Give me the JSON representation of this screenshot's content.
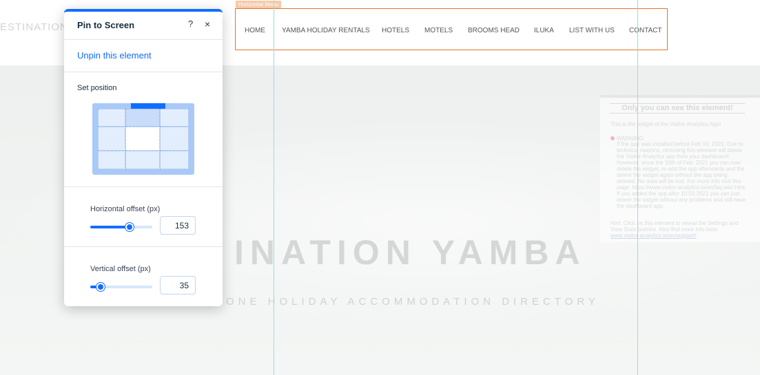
{
  "site": {
    "logo_text": "ESTINATION Y",
    "menu_tag": "Horizontal Menu",
    "menu_items": [
      "HOME",
      "YAMBA HOLIDAY RENTALS",
      "HOTELS",
      "MOTELS",
      "BROOMS HEAD",
      "ILUKA",
      "LIST WITH US",
      "CONTACT"
    ],
    "hero_title": "INATION YAMBA",
    "hero_subtitle": "ONE HOLIDAY ACCOMMODATION DIRECTORY"
  },
  "widget": {
    "title": "Only you can see this element!",
    "intro": "This is the widget of the Visitor Analytics App!",
    "warning_label": "WARNING:",
    "warning_text": "If the app was installed before Feb 10, 2021: Due to technical reasons, removing this element will delete the Visitor Analytics app from your dashboard! However, since the 10th of Feb. 2021 you can now delete the widget, re-add the app afterwards and the delete the widget again without the app being deleted. No data will be lost. For more info visit this page: https://www.visitor-analytics.io/en/faq-wix/ Hint: If you added the app after 10.02.2021 you can just delete the widget without any problems and still have the dashboard app.",
    "link": "https://www.visitor-analytics.io/en/faq-wix/",
    "hint": "Hint: Click on this element to reveal the Settings and View Stats buttons. Also find more info here:",
    "hint_link": "www.visitor-analytics.io/en/support/"
  },
  "panel": {
    "title": "Pin to Screen",
    "help_icon": "?",
    "close_icon": "×",
    "unpin_label": "Unpin this element",
    "set_position_label": "Set position",
    "horizontal": {
      "label": "Horizontal offset (px)",
      "value": "153",
      "slider_fraction": 0.63
    },
    "vertical": {
      "label": "Vertical offset (px)",
      "value": "35",
      "slider_fraction": 0.17
    },
    "accent": "#116dff"
  }
}
